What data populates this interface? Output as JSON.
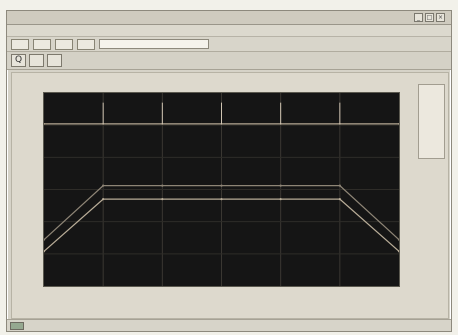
{
  "window": {
    "title": "",
    "controls": [
      "_",
      "□",
      "×"
    ]
  },
  "menu": {
    "items": []
  },
  "toolbar": {
    "buttons": [
      "",
      "",
      "",
      ""
    ],
    "field_text": ""
  },
  "subtoolbar": {
    "buttons": [
      "Q",
      "",
      ""
    ],
    "text": ""
  },
  "chart": {
    "title": "",
    "xlabel": "",
    "ylabel": "",
    "legend": []
  },
  "status": {
    "text": ""
  },
  "colors": {
    "window_bg": "#d6d3c8",
    "plot_bg": "#151515",
    "plot_line": "#9a948b",
    "accent": "#c8b79b",
    "status_box": "#95a890"
  },
  "chart_data": {
    "type": "line",
    "title": "",
    "xlabel": "",
    "ylabel": "",
    "x": [
      0,
      1,
      2,
      3,
      4,
      5,
      6
    ],
    "series": [
      {
        "values": [
          0.18,
          0.45,
          0.45,
          0.45,
          0.45,
          0.45,
          0.18
        ]
      },
      {
        "values": [
          0.24,
          0.52,
          0.52,
          0.52,
          0.52,
          0.52,
          0.24
        ]
      },
      {
        "values": [
          0.84,
          0.84,
          0.84,
          0.84,
          0.84,
          0.84,
          0.84
        ]
      }
    ],
    "xlim": [
      0,
      6
    ],
    "ylim": [
      0,
      1
    ],
    "grid": true,
    "legend_position": "right"
  }
}
